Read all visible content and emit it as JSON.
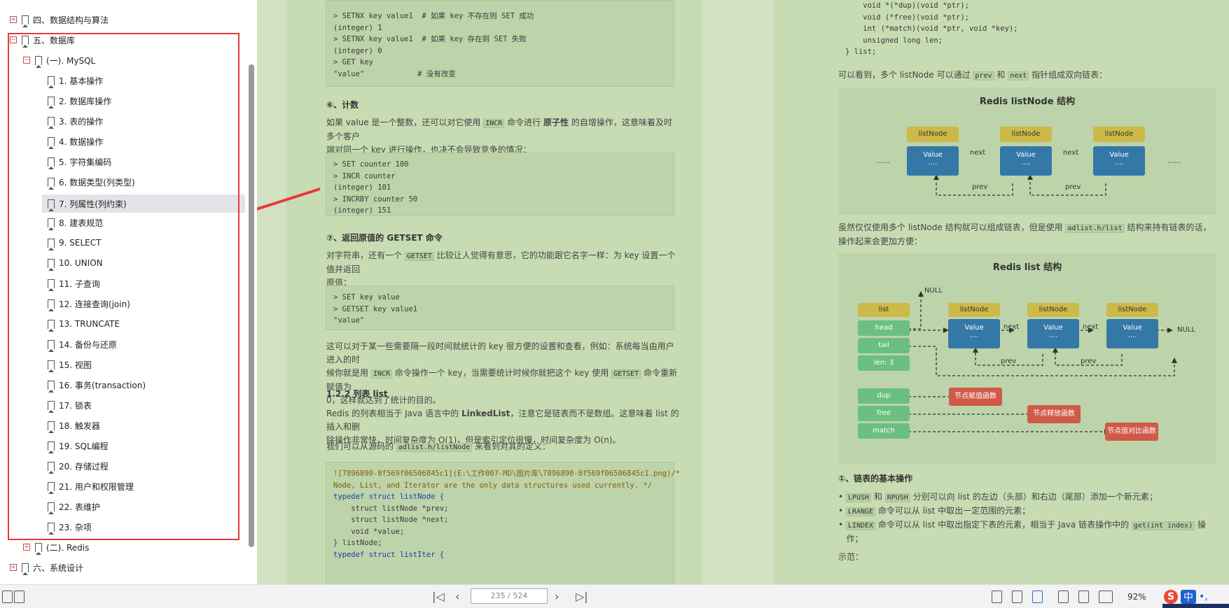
{
  "sidebar": {
    "sections": [
      {
        "label": "四、数据结构与算法",
        "expand": "+"
      },
      {
        "label": "五、数据库",
        "expand": "−"
      },
      {
        "label": "(一). MySQL",
        "expand": "−"
      },
      {
        "label": "1. 基本操作"
      },
      {
        "label": "2. 数据库操作"
      },
      {
        "label": "3. 表的操作"
      },
      {
        "label": "4. 数据操作"
      },
      {
        "label": "5. 字符集编码"
      },
      {
        "label": "6. 数据类型(列类型)"
      },
      {
        "label": "7. 列属性(列约束)"
      },
      {
        "label": "8. 建表规范"
      },
      {
        "label": "9. SELECT"
      },
      {
        "label": "10. UNION"
      },
      {
        "label": "11. 子查询"
      },
      {
        "label": "12. 连接查询(join)"
      },
      {
        "label": "13. TRUNCATE"
      },
      {
        "label": "14. 备份与还原"
      },
      {
        "label": "15. 视图"
      },
      {
        "label": "16. 事务(transaction)"
      },
      {
        "label": "17. 锁表"
      },
      {
        "label": "18. 触发器"
      },
      {
        "label": "19. SQL编程"
      },
      {
        "label": "20. 存储过程"
      },
      {
        "label": "21. 用户和权限管理"
      },
      {
        "label": "22. 表维护"
      },
      {
        "label": "23. 杂项"
      },
      {
        "label": "(二). Redis",
        "expand": "+"
      },
      {
        "label": "六、系统设计",
        "expand": "+"
      }
    ]
  },
  "left_page": {
    "code1": [
      "> SETNX key value1  # 如果 key 不存在则 SET 成功",
      "(integer) 1",
      "> SETNX key value1  # 如果 key 存在则 SET 失败",
      "(integer) 0",
      "> GET key",
      "\"value\"            # 没有改变"
    ],
    "h6": "⑥、计数",
    "p6a": "如果 value 是一个整数，还可以对它使用",
    "p6code": "INCR",
    "p6b": "命令进行",
    "p6bold": "原子性",
    "p6c": "的自增操作，这意味着及时多个客户",
    "p6d": "端对同一个 key 进行操作，也决不会导致竞争的情况：",
    "code2": [
      "> SET counter 100",
      "> INCR counter",
      "(integer) 101",
      "> INCRBY counter 50",
      "(integer) 151"
    ],
    "h7": "⑦、返回原值的 GETSET 命令",
    "p7a": "对字符串，还有一个",
    "p7code": "GETSET",
    "p7b": "比较让人觉得有意思，它的功能跟它名字一样：为 key 设置一个值并返回",
    "p7c": "原值：",
    "code3": [
      "> SET key value",
      "> GETSET key value1",
      "\"value\""
    ],
    "p8a": "这可以对于某一些需要隔一段时间就统计的 key 很方便的设置和查看，例如：系统每当由用户进入的时",
    "p8b1": "候你就是用",
    "p8code1": "INCR",
    "p8b2": "命令操作一个 key，当需要统计时候你就把这个 key 使用",
    "p8code2": "GETSET",
    "p8b3": "命令重新赋值为",
    "p8c": "0，这样就达到了统计的目的。",
    "h_list": "1.2.2 列表 list",
    "p9a1": "Redis 的列表相当于 Java 语言中的",
    "p9bold": "LinkedList",
    "p9a2": "，注意它是链表而不是数组。这意味着 list 的插入和删",
    "p9b": "除操作非常快，时间复杂度为 O(1)，但是索引定位很慢，时间复杂度为 O(n)。",
    "p10a": "我们可以从源码的",
    "p10code": "adlist.h/listNode",
    "p10b": "来看到对其的定义：",
    "code4": [
      "![7896890-8f569f06506845c1](E:\\工作007-MD\\图片库\\7896890-8f569f06506845c1.png)/*",
      "Node, List, and Iterator are the only data structures used currently. */",
      "",
      "typedef struct listNode {",
      "    struct listNode *prev;",
      "    struct listNode *next;",
      "    void *value;",
      "} listNode;",
      "",
      "typedef struct listIter {"
    ]
  },
  "right_page": {
    "code_top": [
      "    void *(*dup)(void *ptr);",
      "    void (*free)(void *ptr);",
      "    int (*match)(void *ptr, void *key);",
      "    unsigned long len;",
      "} list;"
    ],
    "p1a": "可以看到，多个 listNode 可以通过",
    "p1c1": "prev",
    "p1b": "和",
    "p1c2": "next",
    "p1d": "指针组成双向链表：",
    "diag1": {
      "title": "Redis listNode 结构",
      "node": "listNode",
      "value": "Value",
      "dots": "....",
      "next": "next",
      "prev": "prev",
      "ellipsis": "......"
    },
    "p2a": "虽然仅仅使用多个 listNode 结构就可以组成链表，但是使用",
    "p2code": "adlist.h/list",
    "p2b": "结构来持有链表的话，",
    "p2c": "操作起来会更加方便：",
    "diag2": {
      "title": "Redis list 结构",
      "list": "list",
      "head": "head",
      "tail": "tail",
      "len": "len: 3",
      "dup": "dup",
      "free": "free",
      "match": "match",
      "null": "NULL",
      "node": "listNode",
      "value": "Value",
      "dots": "....",
      "next": "next",
      "prev": "prev",
      "f1": "节点赋值函数",
      "f2": "节点释放函数",
      "f3": "节点值对比函数"
    },
    "h1": "①、链表的基本操作",
    "b1code1": "LPUSH",
    "b1a": "和",
    "b1code2": "RPUSH",
    "b1b": "分别可以向 list 的左边（头部）和右边（尾部）添加一个新元素；",
    "b2code": "LRANGE",
    "b2a": "命令可以从 list 中取出一定范围的元素；",
    "b3code": "LINDEX",
    "b3a": "命令可以从 list 中取出指定下表的元素，相当于 Java 链表操作中的",
    "b3code2": "get(int index)",
    "b3b": "操",
    "b3c": "作；",
    "p3": "示范："
  },
  "bottombar": {
    "page": "235 / 524",
    "zoom": "92%",
    "ime_zh": "中",
    "ime_rest": "•,"
  }
}
